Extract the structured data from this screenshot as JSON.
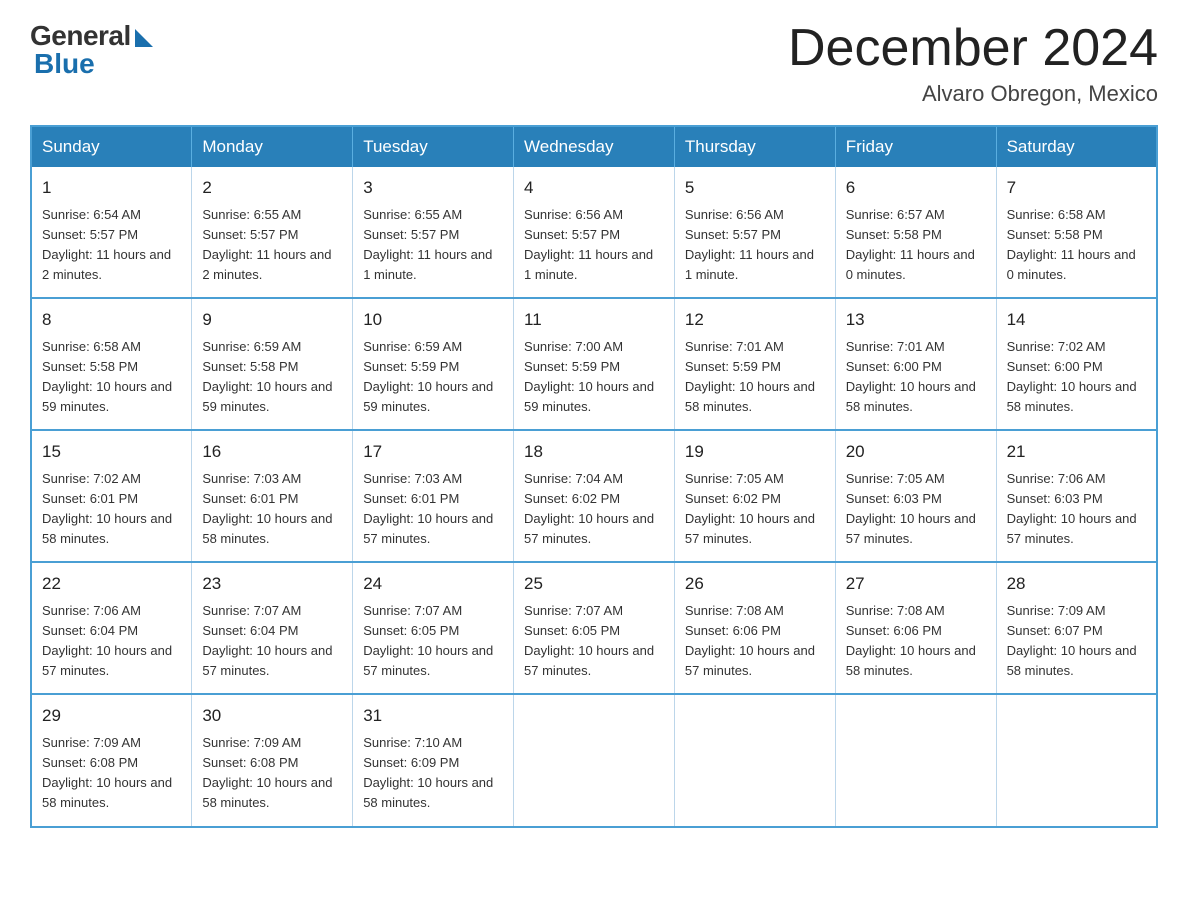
{
  "header": {
    "logo_general": "General",
    "logo_blue": "Blue",
    "title": "December 2024",
    "location": "Alvaro Obregon, Mexico"
  },
  "calendar": {
    "days_of_week": [
      "Sunday",
      "Monday",
      "Tuesday",
      "Wednesday",
      "Thursday",
      "Friday",
      "Saturday"
    ],
    "weeks": [
      [
        {
          "day": "1",
          "sunrise": "6:54 AM",
          "sunset": "5:57 PM",
          "daylight": "11 hours and 2 minutes."
        },
        {
          "day": "2",
          "sunrise": "6:55 AM",
          "sunset": "5:57 PM",
          "daylight": "11 hours and 2 minutes."
        },
        {
          "day": "3",
          "sunrise": "6:55 AM",
          "sunset": "5:57 PM",
          "daylight": "11 hours and 1 minute."
        },
        {
          "day": "4",
          "sunrise": "6:56 AM",
          "sunset": "5:57 PM",
          "daylight": "11 hours and 1 minute."
        },
        {
          "day": "5",
          "sunrise": "6:56 AM",
          "sunset": "5:57 PM",
          "daylight": "11 hours and 1 minute."
        },
        {
          "day": "6",
          "sunrise": "6:57 AM",
          "sunset": "5:58 PM",
          "daylight": "11 hours and 0 minutes."
        },
        {
          "day": "7",
          "sunrise": "6:58 AM",
          "sunset": "5:58 PM",
          "daylight": "11 hours and 0 minutes."
        }
      ],
      [
        {
          "day": "8",
          "sunrise": "6:58 AM",
          "sunset": "5:58 PM",
          "daylight": "10 hours and 59 minutes."
        },
        {
          "day": "9",
          "sunrise": "6:59 AM",
          "sunset": "5:58 PM",
          "daylight": "10 hours and 59 minutes."
        },
        {
          "day": "10",
          "sunrise": "6:59 AM",
          "sunset": "5:59 PM",
          "daylight": "10 hours and 59 minutes."
        },
        {
          "day": "11",
          "sunrise": "7:00 AM",
          "sunset": "5:59 PM",
          "daylight": "10 hours and 59 minutes."
        },
        {
          "day": "12",
          "sunrise": "7:01 AM",
          "sunset": "5:59 PM",
          "daylight": "10 hours and 58 minutes."
        },
        {
          "day": "13",
          "sunrise": "7:01 AM",
          "sunset": "6:00 PM",
          "daylight": "10 hours and 58 minutes."
        },
        {
          "day": "14",
          "sunrise": "7:02 AM",
          "sunset": "6:00 PM",
          "daylight": "10 hours and 58 minutes."
        }
      ],
      [
        {
          "day": "15",
          "sunrise": "7:02 AM",
          "sunset": "6:01 PM",
          "daylight": "10 hours and 58 minutes."
        },
        {
          "day": "16",
          "sunrise": "7:03 AM",
          "sunset": "6:01 PM",
          "daylight": "10 hours and 58 minutes."
        },
        {
          "day": "17",
          "sunrise": "7:03 AM",
          "sunset": "6:01 PM",
          "daylight": "10 hours and 57 minutes."
        },
        {
          "day": "18",
          "sunrise": "7:04 AM",
          "sunset": "6:02 PM",
          "daylight": "10 hours and 57 minutes."
        },
        {
          "day": "19",
          "sunrise": "7:05 AM",
          "sunset": "6:02 PM",
          "daylight": "10 hours and 57 minutes."
        },
        {
          "day": "20",
          "sunrise": "7:05 AM",
          "sunset": "6:03 PM",
          "daylight": "10 hours and 57 minutes."
        },
        {
          "day": "21",
          "sunrise": "7:06 AM",
          "sunset": "6:03 PM",
          "daylight": "10 hours and 57 minutes."
        }
      ],
      [
        {
          "day": "22",
          "sunrise": "7:06 AM",
          "sunset": "6:04 PM",
          "daylight": "10 hours and 57 minutes."
        },
        {
          "day": "23",
          "sunrise": "7:07 AM",
          "sunset": "6:04 PM",
          "daylight": "10 hours and 57 minutes."
        },
        {
          "day": "24",
          "sunrise": "7:07 AM",
          "sunset": "6:05 PM",
          "daylight": "10 hours and 57 minutes."
        },
        {
          "day": "25",
          "sunrise": "7:07 AM",
          "sunset": "6:05 PM",
          "daylight": "10 hours and 57 minutes."
        },
        {
          "day": "26",
          "sunrise": "7:08 AM",
          "sunset": "6:06 PM",
          "daylight": "10 hours and 57 minutes."
        },
        {
          "day": "27",
          "sunrise": "7:08 AM",
          "sunset": "6:06 PM",
          "daylight": "10 hours and 58 minutes."
        },
        {
          "day": "28",
          "sunrise": "7:09 AM",
          "sunset": "6:07 PM",
          "daylight": "10 hours and 58 minutes."
        }
      ],
      [
        {
          "day": "29",
          "sunrise": "7:09 AM",
          "sunset": "6:08 PM",
          "daylight": "10 hours and 58 minutes."
        },
        {
          "day": "30",
          "sunrise": "7:09 AM",
          "sunset": "6:08 PM",
          "daylight": "10 hours and 58 minutes."
        },
        {
          "day": "31",
          "sunrise": "7:10 AM",
          "sunset": "6:09 PM",
          "daylight": "10 hours and 58 minutes."
        },
        null,
        null,
        null,
        null
      ]
    ]
  }
}
